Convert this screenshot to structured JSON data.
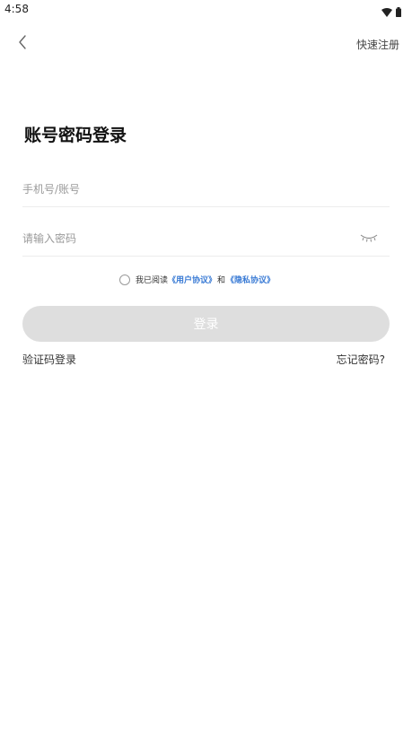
{
  "status_bar": {
    "time": "4:58",
    "icons": [
      "wifi-icon",
      "battery-icon"
    ]
  },
  "header": {
    "back_icon": "chevron-left-icon",
    "quick_register_label": "快速注册"
  },
  "page": {
    "title": "账号密码登录"
  },
  "form": {
    "account_placeholder": "手机号/账号",
    "account_value": "",
    "password_placeholder": "请输入密码",
    "password_value": "",
    "password_toggle_icon": "eye-closed-icon"
  },
  "agreement": {
    "checked": false,
    "prefix": "我已阅读",
    "user_agreement": "《用户协议》",
    "and": "和",
    "privacy_agreement": "《隐私协议》"
  },
  "actions": {
    "login_label": "登录",
    "sms_login_label": "验证码登录",
    "forgot_password_label": "忘记密码?"
  },
  "colors": {
    "link": "#3a7bd5",
    "button_disabled": "#dedede",
    "divider": "#ececec"
  }
}
